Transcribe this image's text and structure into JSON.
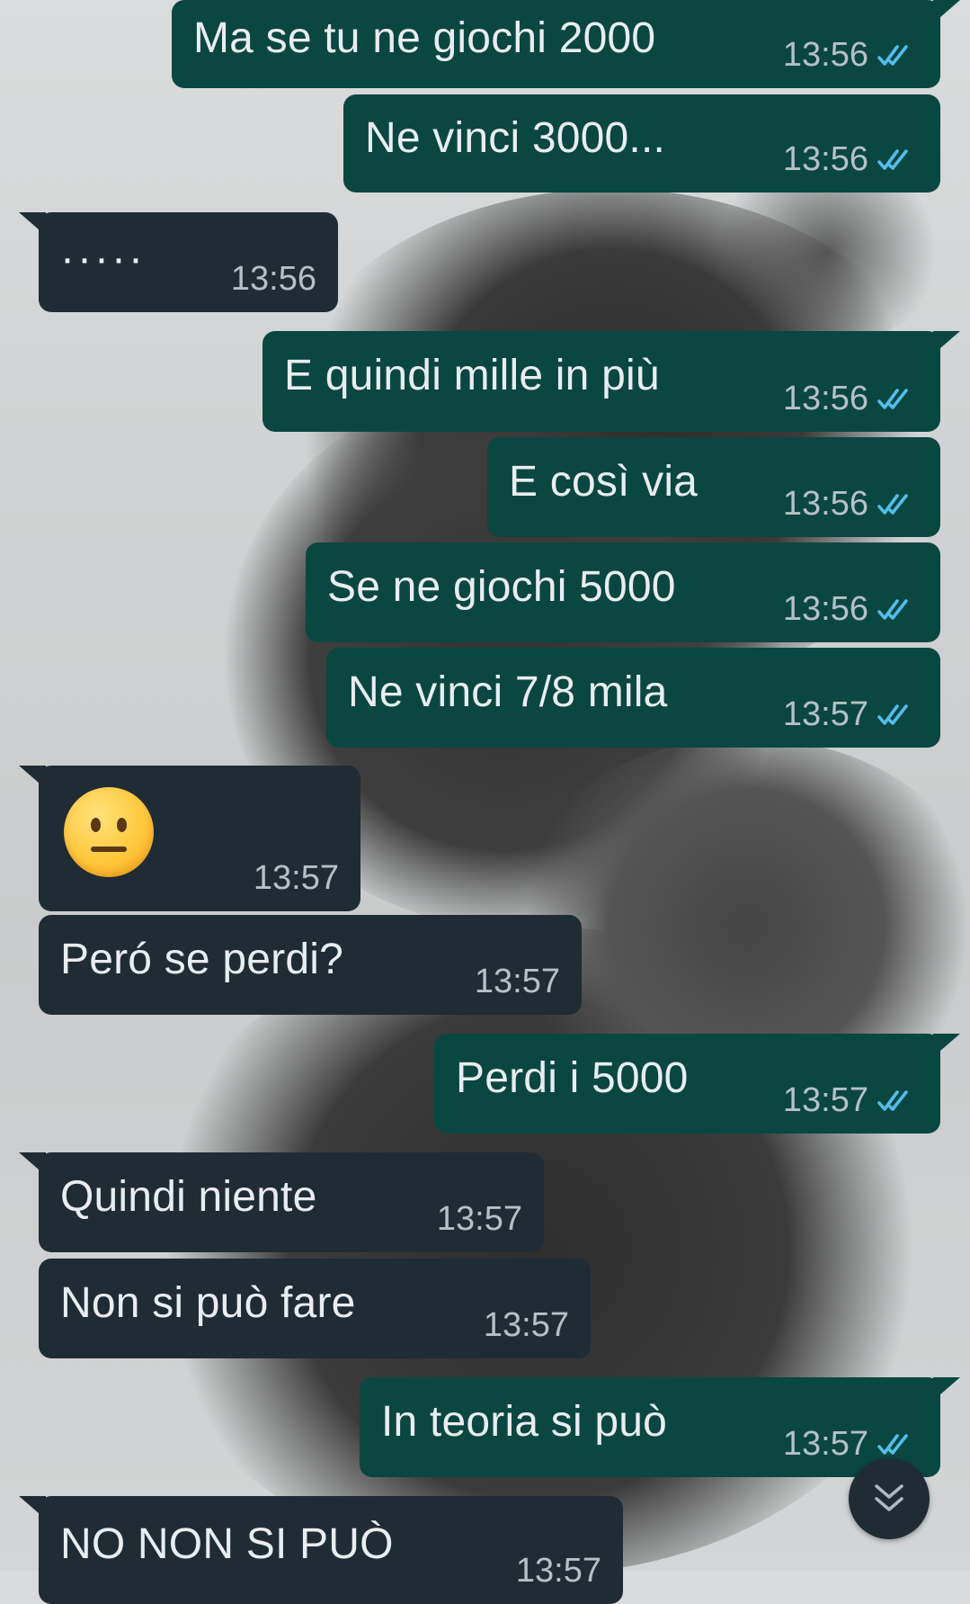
{
  "theme": {
    "outgoing_bubble": "#0a4740",
    "incoming_bubble": "#1f2c34",
    "read_tick_color": "#53bdeb",
    "time_color": "#b7c1c5"
  },
  "messages": [
    {
      "direction": "out",
      "text": "Ma se tu ne giochi 2000",
      "time": "13:56",
      "status": "read"
    },
    {
      "direction": "out",
      "text": "Ne vinci 3000...",
      "time": "13:56",
      "status": "read"
    },
    {
      "direction": "in",
      "text": "·····",
      "time": "13:56"
    },
    {
      "direction": "out",
      "text": "E quindi mille in più",
      "time": "13:56",
      "status": "read"
    },
    {
      "direction": "out",
      "text": "E così via",
      "time": "13:56",
      "status": "read"
    },
    {
      "direction": "out",
      "text": "Se ne giochi 5000",
      "time": "13:56",
      "status": "read"
    },
    {
      "direction": "out",
      "text": "Ne vinci 7/8 mila",
      "time": "13:57",
      "status": "read"
    },
    {
      "direction": "in",
      "emoji": "neutral-face",
      "time": "13:57"
    },
    {
      "direction": "in",
      "text": "Peró se perdi?",
      "time": "13:57"
    },
    {
      "direction": "out",
      "text": "Perdi i 5000",
      "time": "13:57",
      "status": "read"
    },
    {
      "direction": "in",
      "text": "Quindi niente",
      "time": "13:57"
    },
    {
      "direction": "in",
      "text": "Non si può fare",
      "time": "13:57"
    },
    {
      "direction": "out",
      "text": "In teoria si può",
      "time": "13:57",
      "status": "read"
    },
    {
      "direction": "in",
      "text": "NO NON SI PUÒ",
      "time": "13:57"
    }
  ],
  "scroll_button": {
    "icon": "double-chevron-down-icon"
  }
}
